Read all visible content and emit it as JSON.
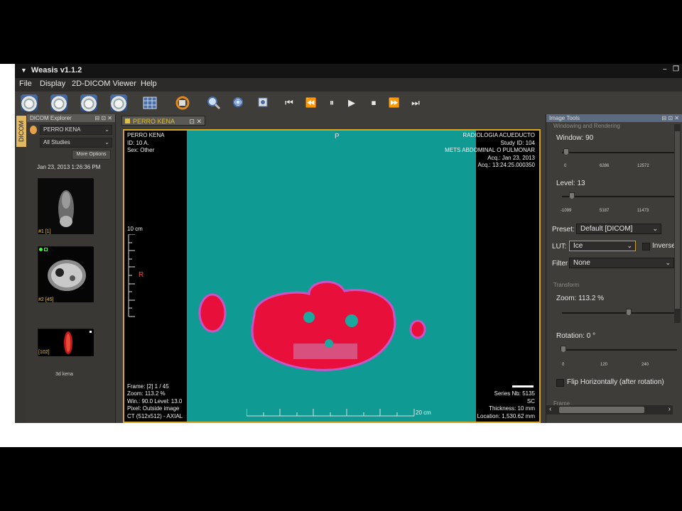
{
  "app": {
    "title": "Weasis v1.1.2",
    "menu": [
      "File",
      "Display",
      "2D-DICOM Viewer",
      "Help"
    ]
  },
  "sidebar": {
    "dicom_tab": "DICOM",
    "explorer_title": "DICOM Explorer",
    "patient": "PERRO KENA",
    "studies": "All Studies",
    "more_options": "More Options",
    "study_date": "Jan 23, 2013 1:26:36 PM",
    "thumbs": [
      {
        "label": "#1 [1]"
      },
      {
        "label": "#2 [45]"
      },
      {
        "label": "[102]",
        "caption": "3d kena"
      }
    ]
  },
  "viewer": {
    "tab_label": "PERRO KENA",
    "top_marker": "P",
    "side_marker": "R",
    "scale_label": "10 cm",
    "bottom_scale": "20 cm",
    "top_left": [
      "PERRO KENA",
      "ID: 10 A.",
      "Sex: Other"
    ],
    "top_right": [
      "RADIOLOGIA ACUEDUCTO",
      "Study ID: 104",
      "METS ABDOMINAL O PULMONAR",
      "Acq.: Jan 23, 2013",
      "Acq.: 13:24:25.000350"
    ],
    "bottom_left": [
      "Frame: [2] 1 / 45",
      "Zoom: 113.2 %",
      "Win.: 90.0 Level: 13.0",
      "Pixel: Outside image",
      "CT (512x512) - AXIAL"
    ],
    "bottom_right": [
      "Series Nb: 5135",
      "SC",
      "Thickness: 10 mm",
      "Location: 1,530.62 mm"
    ]
  },
  "image_tools": {
    "title": "Image Tools",
    "windowing_section": "Windowing and Rendering",
    "window_label": "Window: 90",
    "window_value": 90,
    "window_ticks": [
      "0",
      "6286",
      "12572"
    ],
    "level_label": "Level: 13",
    "level_value": 13,
    "level_ticks": [
      "-1099",
      "5187",
      "11473"
    ],
    "preset_label": "Preset:",
    "preset_value": "Default [DICOM]",
    "lut_label": "LUT:",
    "lut_value": "Ice",
    "inverse_label": "Inverse",
    "filter_label": "Filter",
    "filter_value": "None",
    "transform_section": "Transform",
    "zoom_label": "Zoom: 113.2 %",
    "rotation_label": "Rotation: 0 °",
    "rotation_ticks": [
      "0",
      "120",
      "240"
    ],
    "flip_label": "Flip Horizontally (after rotation)",
    "frame_section": "Frame"
  },
  "colors": {
    "accent": "#d6a620",
    "background_teal": "#0f9b93",
    "overlay_red": "#e8103a"
  }
}
